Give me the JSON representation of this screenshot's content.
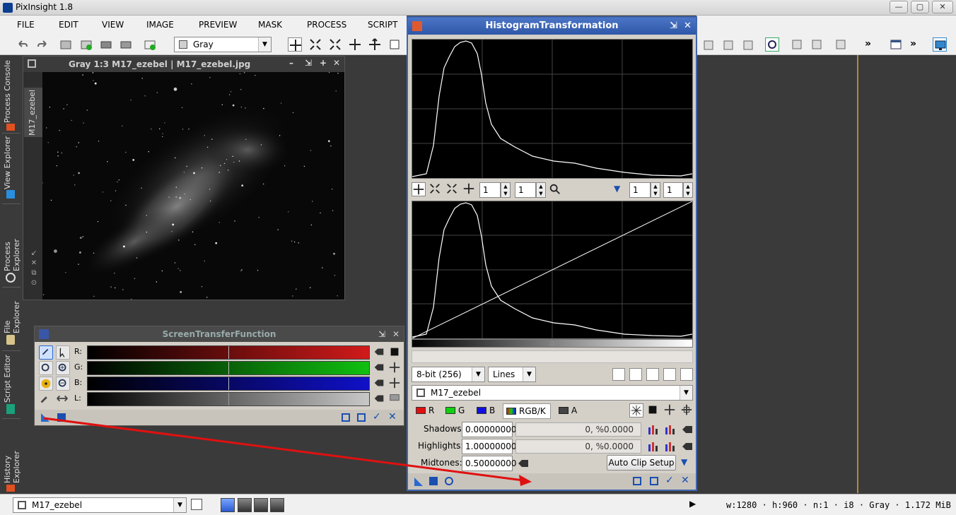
{
  "app": {
    "title": "PixInsight 1.8"
  },
  "window_controls": {
    "minimize": "—",
    "maximize": "▢",
    "close": "✕"
  },
  "menu": [
    "FILE",
    "EDIT",
    "VIEW",
    "IMAGE",
    "PREVIEW",
    "MASK",
    "PROCESS",
    "SCRIPT"
  ],
  "toolbar": {
    "view_combo_value": "Gray",
    "overflow1": "»",
    "overflow2": "»"
  },
  "dock": {
    "tabs": [
      "Process Console",
      "View Explorer",
      "Process Explorer",
      "File Explorer",
      "Script Editor",
      "History Explorer"
    ]
  },
  "image_window": {
    "title": "Gray 1:3 M17_ezebel | M17_ezebel.jpg",
    "side_tab": "M17_ezebel",
    "controls": [
      "–",
      "⇲",
      "+",
      "✕"
    ]
  },
  "stf": {
    "title": "ScreenTransferFunction",
    "channels": [
      {
        "label": "R:",
        "color": "#d11a1a"
      },
      {
        "label": "G:",
        "color": "#10c010"
      },
      {
        "label": "B:",
        "color": "#1010c8"
      },
      {
        "label": "L:",
        "color": "#c8c8c8"
      }
    ]
  },
  "histogram": {
    "title": "HistogramTransformation",
    "zoom_h": "1",
    "zoom_v": "1",
    "zoom_h2": "1",
    "zoom_v2": "1",
    "resolution": "8-bit (256)",
    "graph_style": "Lines",
    "view_name": "M17_ezebel",
    "channels": [
      {
        "label": "R",
        "color": "#e01010"
      },
      {
        "label": "G",
        "color": "#10d010"
      },
      {
        "label": "B",
        "color": "#1010e0"
      },
      {
        "label": "RGB/K",
        "color": "#666666"
      },
      {
        "label": "A",
        "color": "#444444"
      }
    ],
    "shadows_label": "Shadows:",
    "shadows_value": "0.00000000",
    "shadows_readout": "0, %0.0000",
    "highlights_label": "Highlights:",
    "highlights_value": "1.00000000",
    "highlights_readout": "0, %0.0000",
    "midtones_label": "Midtones:",
    "midtones_value": "0.50000000",
    "auto_clip_label": "Auto Clip Setup"
  },
  "status": {
    "view_combo": "M17_ezebel",
    "info": "w:1280 · h:960 · n:1 · i8 · Gray · 1.172 MiB",
    "play": "▶"
  },
  "colors": {
    "annotation_arrow": "#e01010",
    "histogram_title_bar": "#3a63b4"
  }
}
